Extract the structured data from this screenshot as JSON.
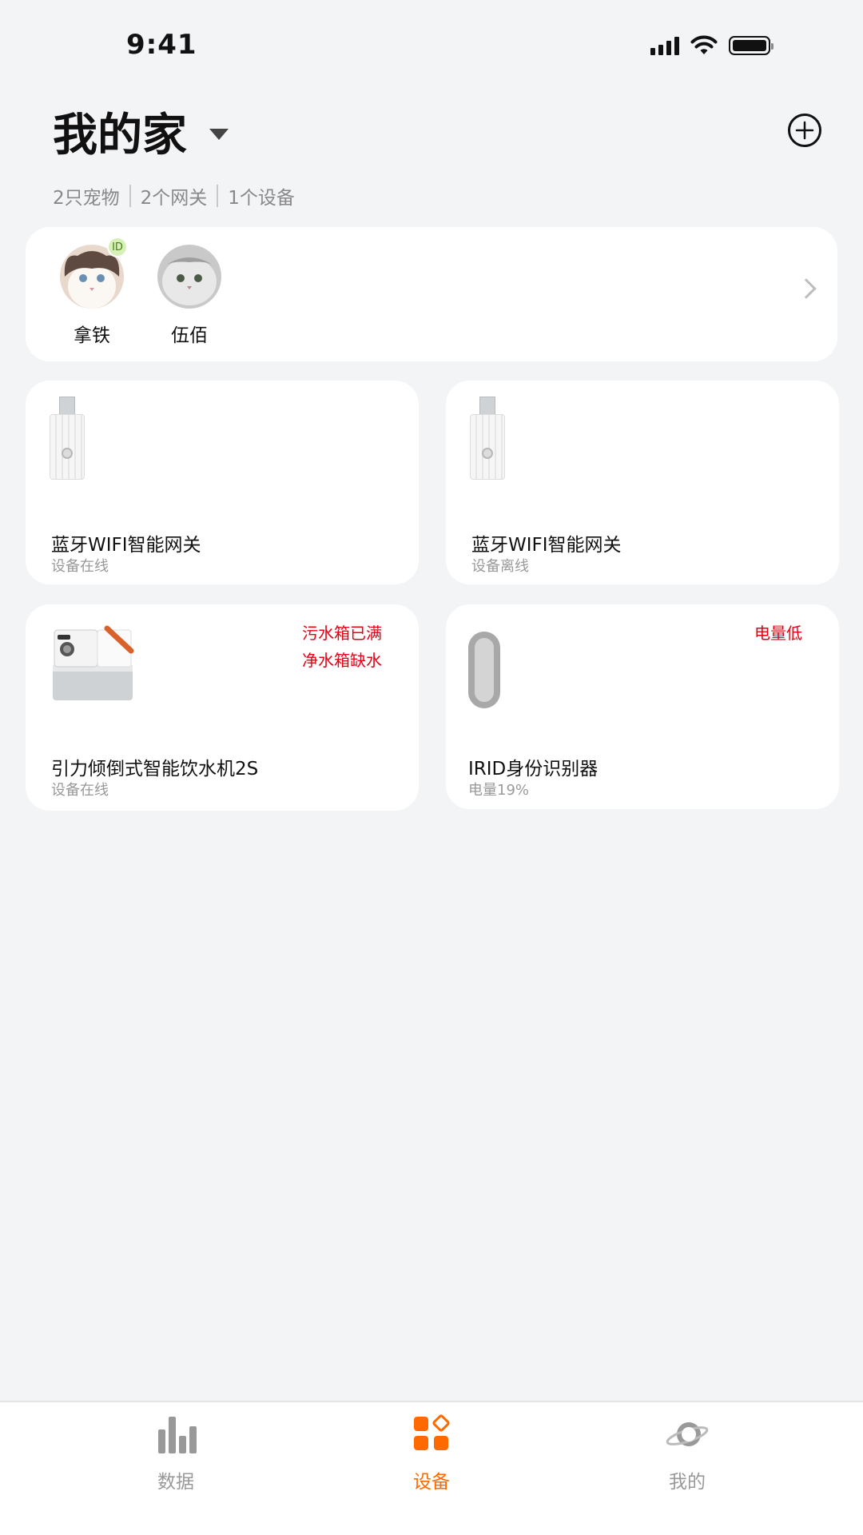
{
  "status_bar": {
    "time": "9:41"
  },
  "header": {
    "title": "我的家",
    "summary": [
      "2只宠物",
      "2个网关",
      "1个设备"
    ]
  },
  "pets": [
    {
      "name": "拿铁",
      "badge": "ID"
    },
    {
      "name": "伍佰"
    }
  ],
  "devices": [
    {
      "name": "蓝牙WIFI智能网关",
      "status": "设备在线",
      "icon": "gateway"
    },
    {
      "name": "蓝牙WIFI智能网关",
      "status": "设备离线",
      "icon": "gateway"
    },
    {
      "name": "引力倾倒式智能饮水机2S",
      "status": "设备在线",
      "icon": "water-fountain",
      "alerts": [
        "污水箱已满",
        "净水箱缺水"
      ]
    },
    {
      "name": "IRID身份识别器",
      "status": "电量19%",
      "icon": "irid-tag",
      "alerts": [
        "电量低"
      ]
    }
  ],
  "tabs": [
    {
      "label": "数据",
      "icon": "bar-chart-icon",
      "active": false
    },
    {
      "label": "设备",
      "icon": "devices-grid-icon",
      "active": true
    },
    {
      "label": "我的",
      "icon": "planet-icon",
      "active": false
    }
  ],
  "colors": {
    "accent": "#ff6a00",
    "alert": "#e60012",
    "background": "#f3f4f6"
  }
}
